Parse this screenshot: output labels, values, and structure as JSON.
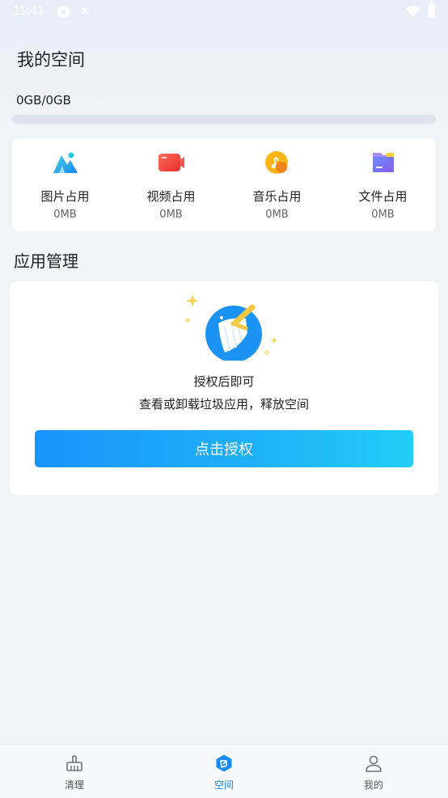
{
  "status_bar": {
    "time": "11:41",
    "extra_icon_text": "⌘"
  },
  "header": {
    "title": "我的空间",
    "usage": "0GB/0GB",
    "usage_progress_percent": 0
  },
  "storage_categories": [
    {
      "label": "图片占用",
      "value": "0MB",
      "icon": "image-icon"
    },
    {
      "label": "视频占用",
      "value": "0MB",
      "icon": "video-icon"
    },
    {
      "label": "音乐占用",
      "value": "0MB",
      "icon": "music-icon"
    },
    {
      "label": "文件占用",
      "value": "0MB",
      "icon": "file-icon"
    }
  ],
  "app_management": {
    "title": "应用管理",
    "auth_title": "授权后即可",
    "auth_desc": "查看或卸载垃圾应用，释放空间",
    "auth_button": "点击授权"
  },
  "bottom_nav": [
    {
      "label": "清理",
      "icon": "broom-icon",
      "active": false
    },
    {
      "label": "空间",
      "icon": "space-icon",
      "active": true
    },
    {
      "label": "我的",
      "icon": "user-icon",
      "active": false
    }
  ],
  "colors": {
    "accent": "#1a8cf5",
    "background": "#f1f3f7",
    "card": "#ffffff"
  }
}
